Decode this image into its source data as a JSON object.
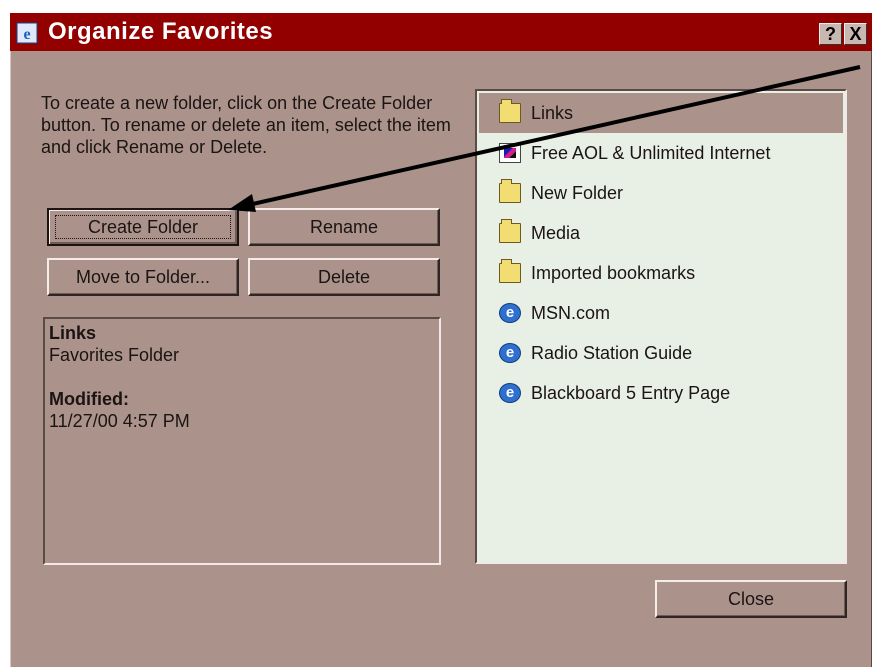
{
  "window": {
    "title": "Organize Favorites",
    "help_label": "?",
    "close_label": "X"
  },
  "instructions": "To create a new folder, click on the Create Folder button. To rename or delete an item, select the item and click Rename or Delete.",
  "buttons": {
    "create_folder": "Create Folder",
    "rename": "Rename",
    "move_to_folder": "Move to Folder...",
    "delete": "Delete",
    "close": "Close"
  },
  "details": {
    "name": "Links",
    "type": "Favorites Folder",
    "modified_label": "Modified:",
    "modified_value": "11/27/00 4:57 PM"
  },
  "favorites": [
    {
      "label": "Links",
      "icon": "folder-icon",
      "selected": true
    },
    {
      "label": "Free AOL & Unlimited Internet",
      "icon": "aol-icon"
    },
    {
      "label": "New Folder",
      "icon": "folder-icon"
    },
    {
      "label": "Media",
      "icon": "folder-icon"
    },
    {
      "label": "Imported bookmarks",
      "icon": "folder-icon"
    },
    {
      "label": "MSN.com",
      "icon": "ie-icon"
    },
    {
      "label": "Radio Station Guide",
      "icon": "ie-icon"
    },
    {
      "label": "Blackboard 5 Entry Page",
      "icon": "ie-icon"
    }
  ],
  "colors": {
    "titlebar": "#920000",
    "window_bg": "#ab938b",
    "list_bg": "#e8f0e6"
  }
}
